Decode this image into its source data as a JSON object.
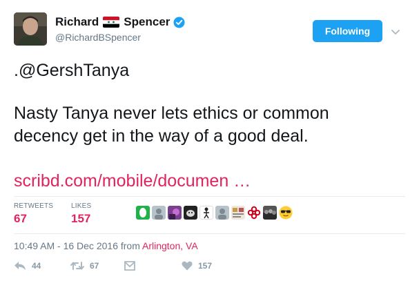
{
  "author": {
    "name_first": "Richard",
    "name_last": "Spencer",
    "handle": "@RichardBSpencer",
    "flag_icon": "syria-flag-icon",
    "verified_icon": "verified-badge-icon"
  },
  "follow_button": {
    "label": "Following",
    "color": "#1da1f2"
  },
  "tweet": {
    "mention": ".@GershTanya",
    "line1": "Nasty Tanya never lets ethics or common",
    "line2": "decency get in the way of a good deal.",
    "link": "scribd.com/mobile/documen …",
    "link_color": "#e0245e"
  },
  "stats": {
    "retweets_label": "RETWEETS",
    "retweets_value": "67",
    "likes_label": "LIKES",
    "likes_value": "157"
  },
  "likers": [
    "green-logo-avatar",
    "default-avatar",
    "purple-photo-avatar",
    "dog-photo-avatar",
    "skeleton-avatar",
    "default-avatar",
    "collage-avatar",
    "red-knot-avatar",
    "crowd-photo-avatar",
    "sunglasses-emoji-avatar"
  ],
  "timestamp": {
    "time": "10:49 AM - 16 Dec 2016 from ",
    "location": "Arlington, VA"
  },
  "actions": {
    "reply_count": "44",
    "retweet_count": "67",
    "likes_count": "157"
  }
}
